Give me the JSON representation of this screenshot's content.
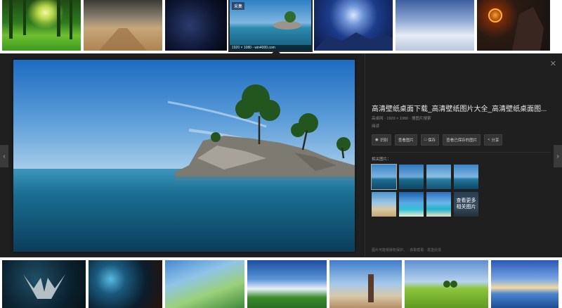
{
  "top_thumbnails": [
    {
      "icon": "green-forest-image"
    },
    {
      "icon": "desert-road-image"
    },
    {
      "icon": "night-sky-image"
    },
    {
      "icon": "island-sea-image",
      "tag": "采集",
      "dimension": "1920 × 1080 - win4000.com",
      "selected": true
    },
    {
      "icon": "planet-space-image"
    },
    {
      "icon": "cloud-sky-image"
    },
    {
      "icon": "dark-warrior-image"
    }
  ],
  "bottom_thumbnails": [
    {
      "icon": "eagle-logo-image"
    },
    {
      "icon": "space-nebula-image"
    },
    {
      "icon": "anime-landscape-image"
    },
    {
      "icon": "sky-grass-image"
    },
    {
      "icon": "anime-girl-image"
    },
    {
      "icon": "green-field-image"
    },
    {
      "icon": "sunset-sea-image"
    }
  ],
  "viewer": {
    "title": "高清壁纸桌面下载_高清壁纸图片大全_高清壁纸桌面图...",
    "meta": "高桌网 · 1920 × 1080 · 搜图片搜索",
    "source": "阅读",
    "actions": [
      {
        "icon": "globe-icon",
        "label": "识别"
      },
      {
        "icon": "",
        "label": "查看图片"
      },
      {
        "icon": "save-icon",
        "label": "保存"
      },
      {
        "icon": "",
        "label": "查看已保存的图片"
      },
      {
        "icon": "share-icon",
        "label": "分享"
      }
    ],
    "related_label": "相关图片：",
    "more_label": "查看更多相关图片",
    "notice": "图片可能受版权保护。 · 获取帮助 · 发送反馈",
    "prev_icon": "chevron-left-icon",
    "next_icon": "chevron-right-icon",
    "close_icon": "close-icon"
  },
  "colors": {
    "viewer_bg": "#1f1f1f",
    "text_primary": "#e8e8e8",
    "text_secondary": "#8a8a8a"
  }
}
